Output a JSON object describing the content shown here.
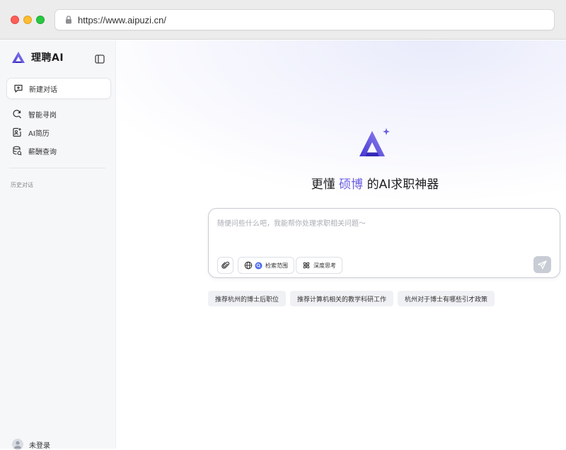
{
  "browser": {
    "url": "https://www.aipuzi.cn/"
  },
  "sidebar": {
    "brand": "理聘AI",
    "new_chat": "新建对话",
    "items": [
      {
        "label": "智能寻岗",
        "icon": "search-refresh-icon"
      },
      {
        "label": "AI简历",
        "icon": "resume-icon"
      },
      {
        "label": "薪酬查询",
        "icon": "database-icon"
      }
    ],
    "history_title": "历史对话",
    "user_label": "未登录"
  },
  "main": {
    "headline_pre": "更懂",
    "headline_highlight": "硕博",
    "headline_post": "的AI求职神器",
    "composer": {
      "placeholder": "随便问些什么吧，我能帮你处理求职相关问题～",
      "search_scope": "检索范围",
      "deep_think": "深度思考"
    },
    "suggestions": [
      "推荐杭州的博士后职位",
      "推荐计算机相关的教学科研工作",
      "杭州对于博士有哪些引才政策"
    ]
  },
  "colors": {
    "accent": "#6b5fe0",
    "brand_gradient_start": "#4d3fd6",
    "brand_gradient_end": "#8b7ff0"
  }
}
